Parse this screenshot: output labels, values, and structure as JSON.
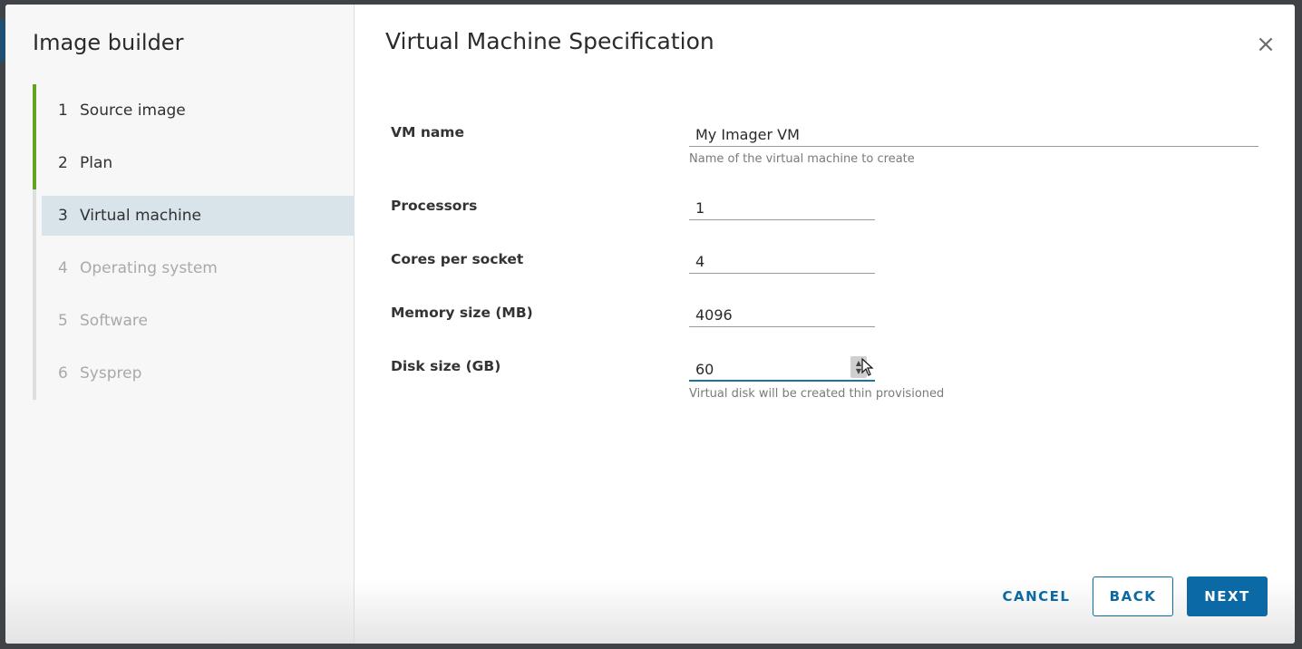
{
  "wizard": {
    "title": "Image builder",
    "steps": [
      {
        "num": "1",
        "label": "Source image"
      },
      {
        "num": "2",
        "label": "Plan"
      },
      {
        "num": "3",
        "label": "Virtual machine"
      },
      {
        "num": "4",
        "label": "Operating system"
      },
      {
        "num": "5",
        "label": "Software"
      },
      {
        "num": "6",
        "label": "Sysprep"
      }
    ]
  },
  "page": {
    "title": "Virtual Machine Specification",
    "close_icon": "×"
  },
  "form": {
    "vm_name": {
      "label": "VM name",
      "value": "My Imager VM",
      "helper": "Name of the virtual machine to create"
    },
    "processors": {
      "label": "Processors",
      "value": "1"
    },
    "cores": {
      "label": "Cores per socket",
      "value": "4"
    },
    "memory": {
      "label": "Memory size (MB)",
      "value": "4096"
    },
    "disk": {
      "label": "Disk size (GB)",
      "value": "60",
      "helper": "Virtual disk will be created thin provisioned"
    }
  },
  "footer": {
    "cancel": "CANCEL",
    "back": "BACK",
    "next": "NEXT"
  },
  "colors": {
    "accent": "#0b6aa5",
    "completed_step": "#62a420",
    "current_step_bg": "#d8e3ea"
  }
}
